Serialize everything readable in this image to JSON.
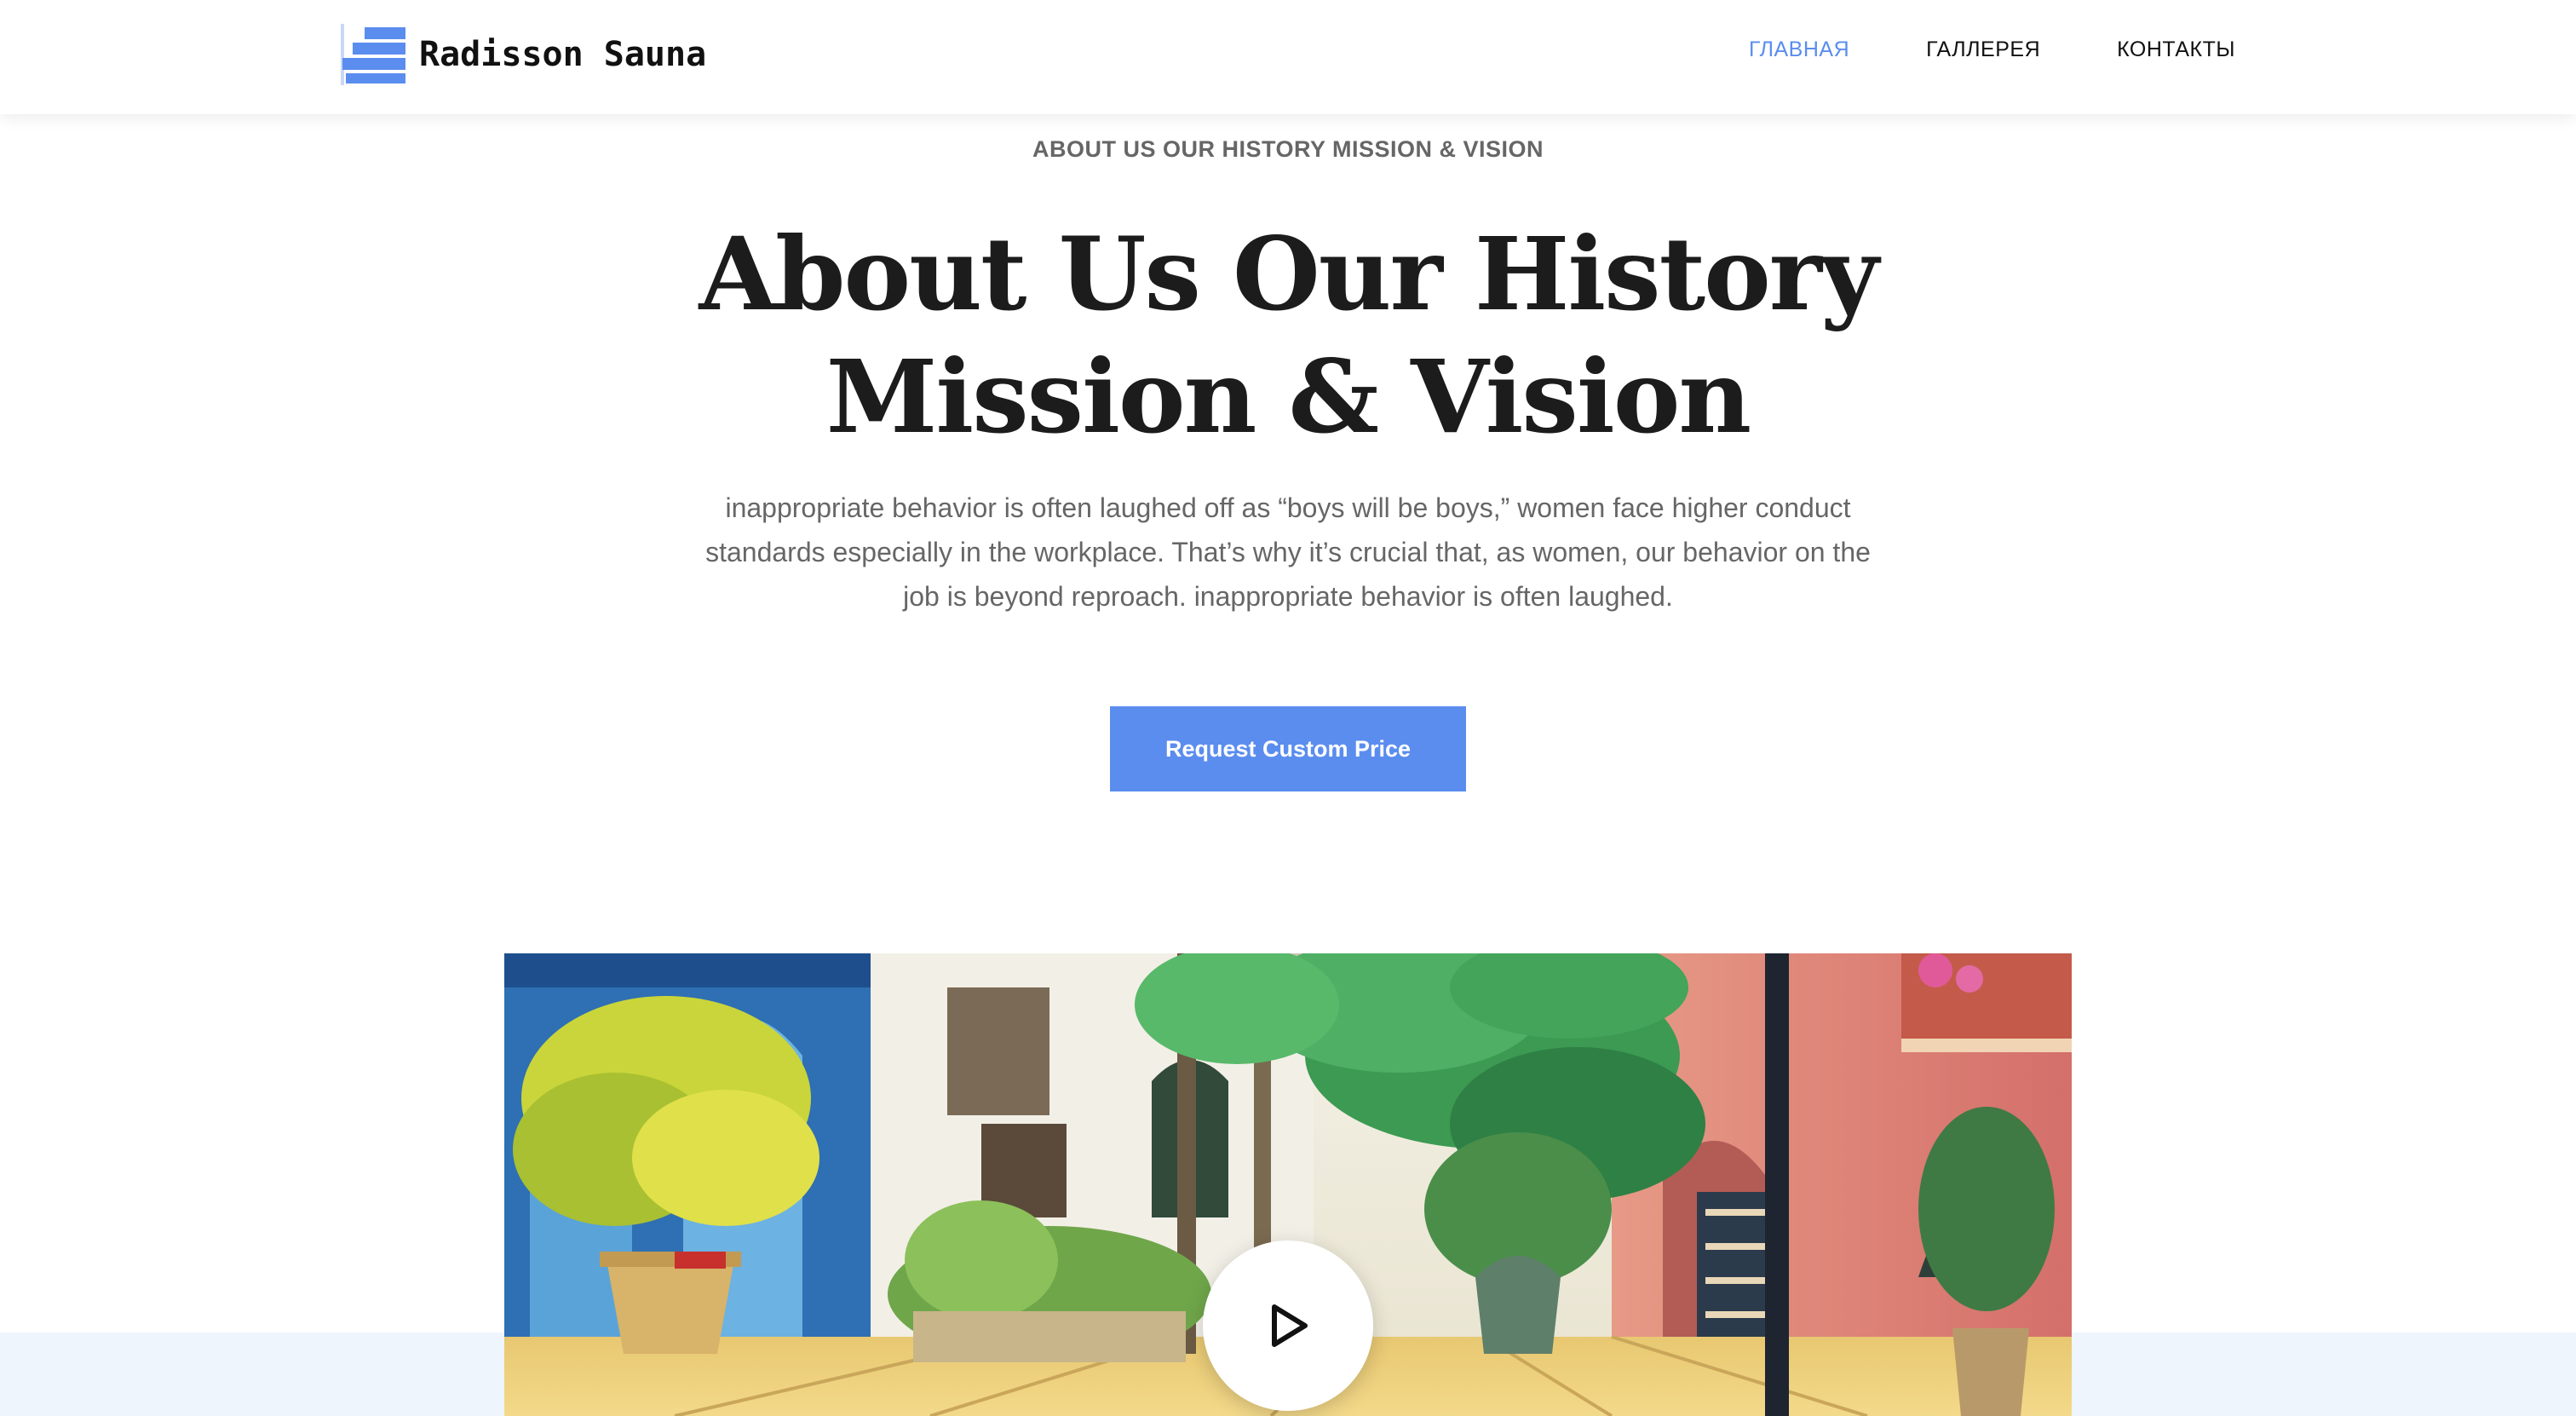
{
  "header": {
    "logo_text": "Radisson Sauna",
    "nav": [
      {
        "label": "ГЛАВНАЯ",
        "active": true
      },
      {
        "label": "ГАЛЛЕРЕЯ",
        "active": false
      },
      {
        "label": "КОНТАКТЫ",
        "active": false
      }
    ]
  },
  "hero": {
    "eyebrow": "ABOUT US OUR HISTORY MISSION & VISION",
    "title_line1": "About Us Our History",
    "title_line2": "Mission & Vision",
    "lead": "inappropriate behavior is often laughed off as “boys will be boys,” women face higher conduct standards especially in the workplace. That’s why it’s crucial that, as women, our behavior on the job is beyond reproach. inappropriate behavior is often laughed.",
    "cta_label": "Request Custom Price"
  },
  "media": {
    "play_icon": "play-icon"
  },
  "colors": {
    "accent": "#5b8def",
    "heading": "#1c1c1c",
    "body_text": "#666666",
    "band": "#eef5fd"
  }
}
